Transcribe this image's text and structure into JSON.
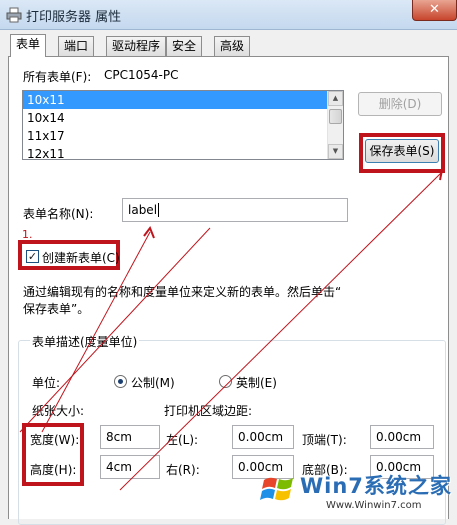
{
  "window": {
    "title": "打印服务器 属性",
    "close_glyph": "✕",
    "icon": "printer-icon"
  },
  "tabs": [
    {
      "label": "表单",
      "active": true
    },
    {
      "label": "端口",
      "active": false
    },
    {
      "label": "驱动程序",
      "active": false
    },
    {
      "label": "安全",
      "active": false
    },
    {
      "label": "高级",
      "active": false
    }
  ],
  "forms": {
    "all_forms_label": "所有表单(F):",
    "server_name": "CPC1054-PC",
    "items": [
      "10x11",
      "10x14",
      "11x17",
      "12x11"
    ],
    "selected_index": 0
  },
  "buttons": {
    "delete": "删除(D)",
    "save": "保存表单(S)"
  },
  "form_name": {
    "label": "表单名称(N):",
    "value": "label",
    "step_marker": "1."
  },
  "create_new": {
    "label": "创建新表单(C)",
    "checked": true,
    "check_glyph": "✓"
  },
  "description": {
    "line1": "通过编辑现有的名称和度量单位来定义新的表单。然后单击“",
    "line2": "保存表单”。"
  },
  "group": {
    "title": "表单描述(度量单位)",
    "unit_label": "单位:",
    "metric_label": "公制(M)",
    "imperial_label": "英制(E)",
    "selected_unit": "metric",
    "paper_size_label": "纸张大小:",
    "margins_label": "打印机区域边距:",
    "width_label": "宽度(W):",
    "width_value": "8cm",
    "height_label": "高度(H):",
    "height_value": "4cm",
    "left_label": "左(L):",
    "left_value": "0.00cm",
    "right_label": "右(R):",
    "right_value": "0.00cm",
    "top_label": "顶端(T):",
    "top_value": "0.00cm",
    "bottom_label": "底部(B):",
    "bottom_value": "0.00cm"
  },
  "watermark": {
    "brand": "Win7系统之家",
    "url": "Www.Winwin7.com"
  },
  "colors": {
    "annotation_red": "#c0141c",
    "selection_blue": "#3399ff"
  }
}
